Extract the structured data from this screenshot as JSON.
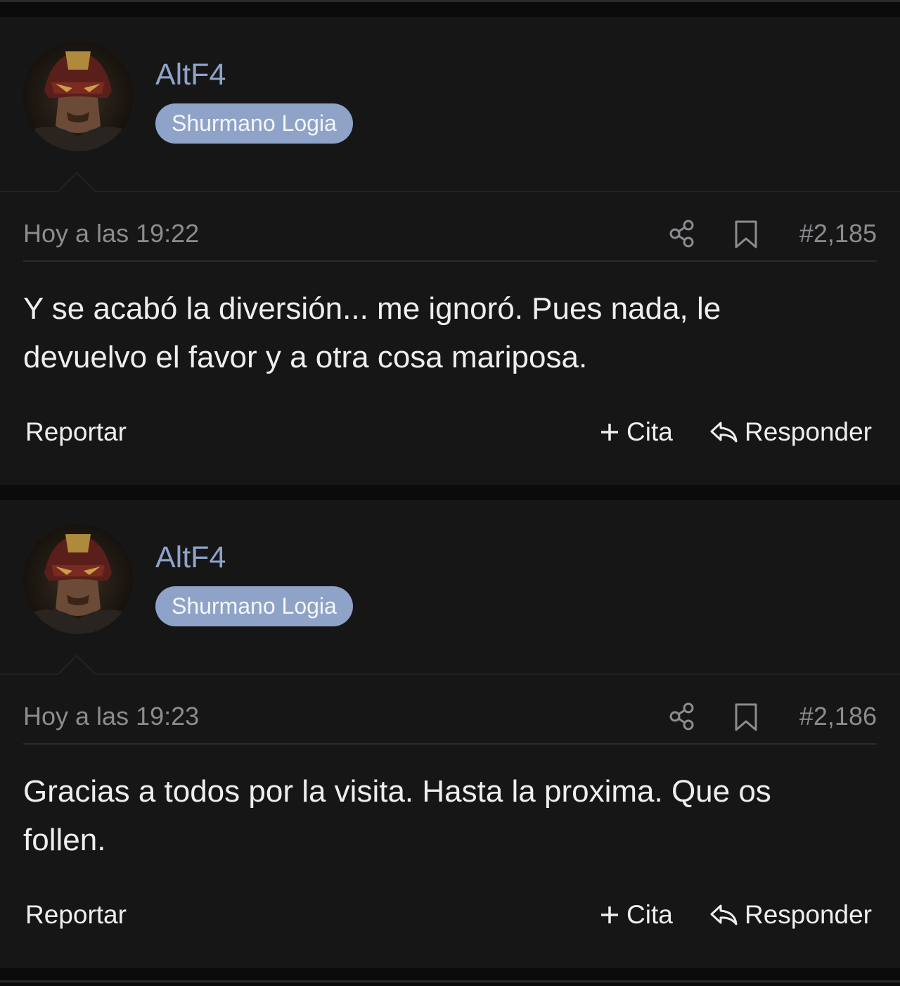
{
  "colors": {
    "accent": "#8fa3c9",
    "post_bg": "#161617",
    "page_bg": "#0b0b0c",
    "text": "#eeeeef",
    "muted": "#8c8c90"
  },
  "posts": [
    {
      "author": {
        "name": "AltF4",
        "badge": "Shurmano Logia",
        "avatar_icon": "avatar-image"
      },
      "timestamp": "Hoy a las 19:22",
      "number": "#2,185",
      "message": "Y se acabó la diversión... me ignoró. Pues nada, le devuelvo el favor y a otra cosa mariposa.",
      "actions": {
        "report": "Reportar",
        "quote": "Cita",
        "reply": "Responder"
      },
      "icons": [
        "share-icon",
        "bookmark-icon",
        "plus-icon",
        "reply-icon"
      ]
    },
    {
      "author": {
        "name": "AltF4",
        "badge": "Shurmano Logia",
        "avatar_icon": "avatar-image"
      },
      "timestamp": "Hoy a las 19:23",
      "number": "#2,186",
      "message": "Gracias a todos por la visita. Hasta la proxima. Que os follen.",
      "actions": {
        "report": "Reportar",
        "quote": "Cita",
        "reply": "Responder"
      },
      "icons": [
        "share-icon",
        "bookmark-icon",
        "plus-icon",
        "reply-icon"
      ]
    }
  ]
}
